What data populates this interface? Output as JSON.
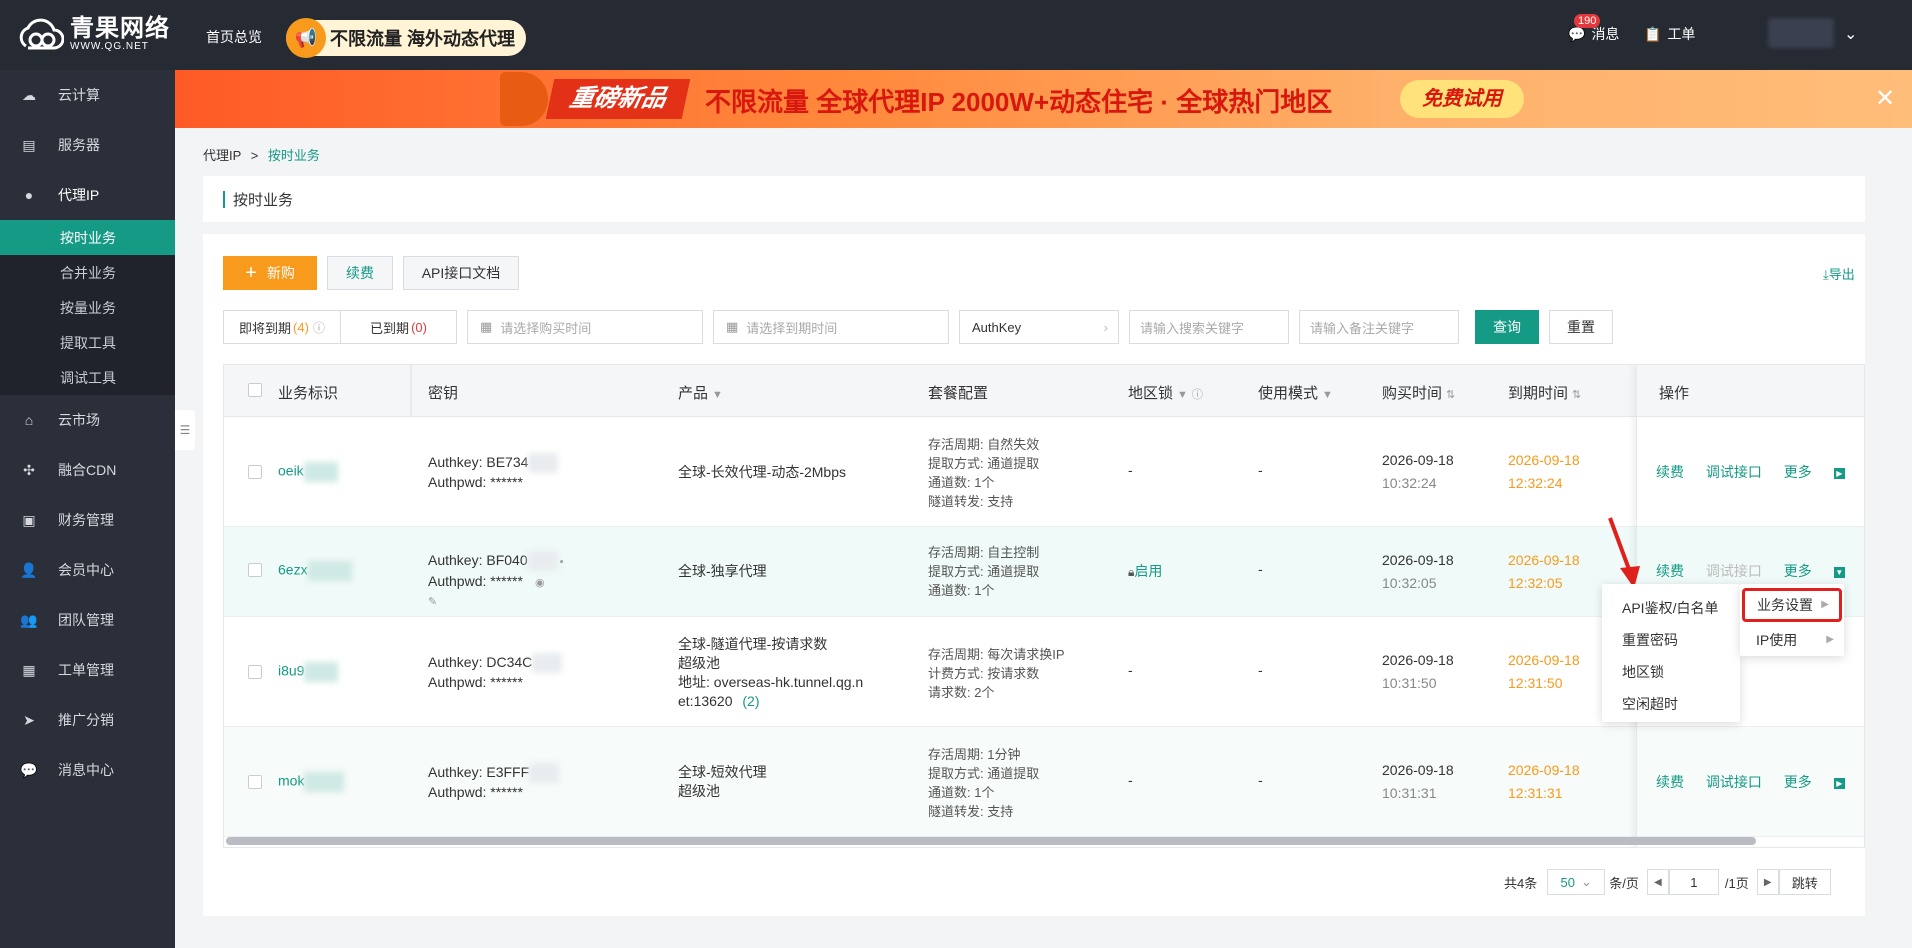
{
  "header": {
    "logo_cn": "青果网络",
    "logo_en": "WWW.QG.NET",
    "nav_home": "首页总览",
    "promo_text": "不限流量 海外动态代理",
    "messages_label": "消息",
    "messages_badge": "190",
    "ticket_label": "工单"
  },
  "sidebar": {
    "items": [
      {
        "label": "云计算",
        "icon": "cloud-icon"
      },
      {
        "label": "服务器",
        "icon": "server-icon"
      },
      {
        "label": "代理IP",
        "icon": "location-pin-icon"
      },
      {
        "label": "云市场",
        "icon": "store-icon"
      },
      {
        "label": "融合CDN",
        "icon": "cdn-icon"
      },
      {
        "label": "财务管理",
        "icon": "wallet-icon"
      },
      {
        "label": "会员中心",
        "icon": "user-icon"
      },
      {
        "label": "团队管理",
        "icon": "team-icon"
      },
      {
        "label": "工单管理",
        "icon": "ticket-icon"
      },
      {
        "label": "推广分销",
        "icon": "send-icon"
      },
      {
        "label": "消息中心",
        "icon": "chat-icon"
      }
    ],
    "sub_items": [
      "按时业务",
      "合并业务",
      "按量业务",
      "提取工具",
      "调试工具"
    ]
  },
  "banner": {
    "tag": "重磅新品",
    "main": "不限流量 全球代理IP 2000W+动态住宅 · 全球热门地区",
    "trial": "免费试用"
  },
  "breadcrumb": {
    "root": "代理IP",
    "sep": ">",
    "current": "按时业务"
  },
  "page_title": "按时业务",
  "toolbar": {
    "new_label": "新购",
    "renew_label": "续费",
    "api_label": "API接口文档",
    "export_label": "导出"
  },
  "filters": {
    "expiring_label": "即将到期",
    "expiring_count": "(4)",
    "expired_label": "已到期",
    "expired_count": "(0)",
    "buy_time_placeholder": "请选择购买时间",
    "expire_time_placeholder": "请选择到期时间",
    "key_type": "AuthKey",
    "keyword_placeholder": "请输入搜索关键字",
    "remark_placeholder": "请输入备注关键字",
    "query_label": "查询",
    "reset_label": "重置"
  },
  "table": {
    "headers": {
      "biz_id": "业务标识",
      "key": "密钥",
      "product": "产品",
      "package": "套餐配置",
      "region_lock": "地区锁",
      "mode": "使用模式",
      "buy_time": "购买时间",
      "expire_time": "到期时间",
      "ops": "操作"
    },
    "rows": [
      {
        "biz_id": "oeik",
        "authkey": "Authkey:  BE734",
        "authpwd": "Authpwd:  ******",
        "product_1": "全球-长效代理-动态-2Mbps",
        "product_2": "",
        "product_3": "",
        "product_4": "",
        "pkg_1": "存活周期:  自然失效",
        "pkg_2": "提取方式:  通道提取",
        "pkg_3": "通道数:  1个",
        "pkg_4": "隧道转发:  支持",
        "region_lock": "-",
        "mode": "-",
        "buy_date": "2026-09-18",
        "buy_time": "10:32:24",
        "exp_date": "2026-09-18",
        "exp_time": "12:32:24",
        "op_renew": "续费",
        "op_debug": "调试接口",
        "op_more": "更多"
      },
      {
        "biz_id": "6ezx",
        "authkey": "Authkey:  BF040",
        "authpwd": "Authpwd:  ******",
        "product_1": "全球-独享代理",
        "product_2": "",
        "product_3": "",
        "product_4": "",
        "pkg_1": "存活周期:  自主控制",
        "pkg_2": "提取方式:  通道提取",
        "pkg_3": "通道数:  1个",
        "pkg_4": "",
        "region_lock": "启用",
        "mode": "-",
        "buy_date": "2026-09-18",
        "buy_time": "10:32:05",
        "exp_date": "2026-09-18",
        "exp_time": "12:32:05",
        "op_renew": "续费",
        "op_debug": "调试接口",
        "op_more": "更多"
      },
      {
        "biz_id": "i8u9",
        "authkey": "Authkey:  DC34C",
        "authpwd": "Authpwd:  ******",
        "product_1": "全球-隧道代理-按请求数",
        "product_2": "超级池",
        "product_3": "地址:  overseas-hk.tunnel.qg.n",
        "product_4": "et:13620",
        "product_4_count": "(2)",
        "pkg_1": "存活周期:  每次请求换IP",
        "pkg_2": "计费方式:  按请求数",
        "pkg_3": "请求数:  2个",
        "pkg_4": "",
        "region_lock": "-",
        "mode": "-",
        "buy_date": "2026-09-18",
        "buy_time": "10:31:50",
        "exp_date": "2026-09-18",
        "exp_time": "12:31:50",
        "op_renew": "",
        "op_debug": "",
        "op_more": ""
      },
      {
        "biz_id": "mok",
        "authkey": "Authkey:  E3FFF",
        "authpwd": "Authpwd:  ******",
        "product_1": "全球-短效代理",
        "product_2": "超级池",
        "product_3": "",
        "product_4": "",
        "pkg_1": "存活周期:  1分钟",
        "pkg_2": "提取方式:  通道提取",
        "pkg_3": "通道数:  1个",
        "pkg_4": "隧道转发:  支持",
        "region_lock": "-",
        "mode": "-",
        "buy_date": "2026-09-18",
        "buy_time": "10:31:31",
        "exp_date": "2026-09-18",
        "exp_time": "12:31:31",
        "op_renew": "续费",
        "op_debug": "调试接口",
        "op_more": "更多"
      }
    ]
  },
  "context_menu": {
    "items": [
      "API鉴权/白名单",
      "重置密码",
      "地区锁",
      "空闲超时"
    ],
    "sub_items": [
      "业务设置",
      "IP使用"
    ]
  },
  "pagination": {
    "total": "共4条",
    "page_size": "50",
    "per_page": "条/页",
    "current": "1",
    "total_pages": "/1页",
    "jump": "跳转"
  },
  "colors": {
    "accent": "#159a85",
    "orange": "#f89a1c",
    "sidebar_bg": "#2b2f3a",
    "topbar_bg": "#262a33"
  }
}
